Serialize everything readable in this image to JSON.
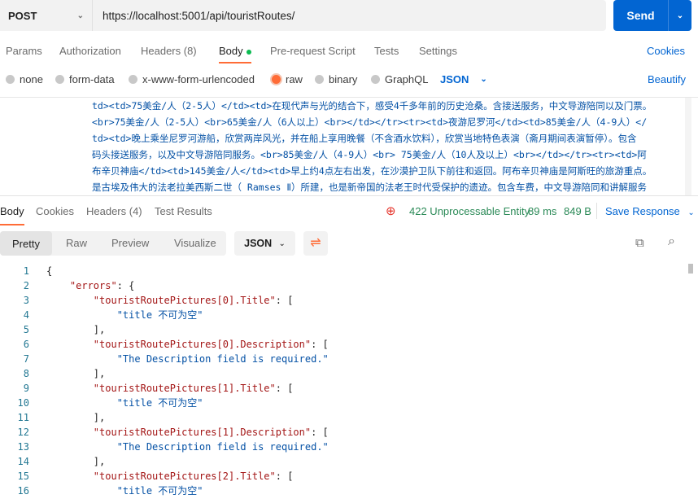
{
  "request": {
    "method": "POST",
    "url": "https://localhost:5001/api/touristRoutes/",
    "send_label": "Send"
  },
  "req_tabs": [
    "Params",
    "Authorization",
    "Headers (8)",
    "Body",
    "Pre-request Script",
    "Tests",
    "Settings"
  ],
  "cookies_label": "Cookies",
  "body_types": [
    "none",
    "form-data",
    "x-www-form-urlencoded",
    "raw",
    "binary",
    "GraphQL"
  ],
  "body_selected": "raw",
  "body_format": "JSON",
  "beautify_label": "Beautify",
  "body_lines": [
    "td><td>75美金/人（2-5人）</td><td>在现代声与光的结合下，感受4千多年前的历史沧桑。含接送服务，中文导游陪同以及门票。",
    "<br>75美金/人（2-5人）<br>65美金/人（6人以上）<br></td></tr><tr><td>夜游尼罗河</td><td>85美金/人（4-9人）</",
    "td><td>晚上乘坐尼罗河游船，欣赏两岸风光，并在船上享用晚餐（不含酒水饮料），欣赏当地特色表演（斋月期间表演暂停）。包含",
    "码头接送服务，以及中文导游陪同服务。<br>85美金/人（4-9人）<br> 75美金/人（10人及以上）<br></td></tr><tr><td>阿",
    "布辛贝神庙</td><td>145美金/人</td><td>早上约4点左右出发，在沙漠护卫队下前往和返回。阿布辛贝神庙是阿斯旺的旅游重点。",
    "是古埃及伟大的法老拉美西斯二世（ Ramses Ⅱ）所建，也是新帝国的法老王时代受保护的遗迹。包含车费，中文导游陪同和讲解服务"
  ],
  "resp_tabs": [
    "Body",
    "Cookies",
    "Headers (4)",
    "Test Results"
  ],
  "status": {
    "code_text": "422 Unprocessable Entity",
    "time": "89 ms",
    "size": "849 B",
    "save_label": "Save Response"
  },
  "view_modes": [
    "Pretty",
    "Raw",
    "Preview",
    "Visualize"
  ],
  "resp_format": "JSON",
  "code_lines": [
    {
      "n": "1",
      "parts": [
        [
          "p",
          "{"
        ]
      ]
    },
    {
      "n": "2",
      "parts": [
        [
          "k",
          "    \"errors\""
        ],
        [
          "p",
          ": {"
        ]
      ]
    },
    {
      "n": "3",
      "parts": [
        [
          "k",
          "        \"touristRoutePictures[0].Title\""
        ],
        [
          "p",
          ": ["
        ]
      ]
    },
    {
      "n": "4",
      "parts": [
        [
          "v",
          "            \"title 不可为空\""
        ]
      ]
    },
    {
      "n": "5",
      "parts": [
        [
          "p",
          "        ],"
        ]
      ]
    },
    {
      "n": "6",
      "parts": [
        [
          "k",
          "        \"touristRoutePictures[0].Description\""
        ],
        [
          "p",
          ": ["
        ]
      ]
    },
    {
      "n": "7",
      "parts": [
        [
          "v",
          "            \"The Description field is required.\""
        ]
      ]
    },
    {
      "n": "8",
      "parts": [
        [
          "p",
          "        ],"
        ]
      ]
    },
    {
      "n": "9",
      "parts": [
        [
          "k",
          "        \"touristRoutePictures[1].Title\""
        ],
        [
          "p",
          ": ["
        ]
      ]
    },
    {
      "n": "10",
      "parts": [
        [
          "v",
          "            \"title 不可为空\""
        ]
      ]
    },
    {
      "n": "11",
      "parts": [
        [
          "p",
          "        ],"
        ]
      ]
    },
    {
      "n": "12",
      "parts": [
        [
          "k",
          "        \"touristRoutePictures[1].Description\""
        ],
        [
          "p",
          ": ["
        ]
      ]
    },
    {
      "n": "13",
      "parts": [
        [
          "v",
          "            \"The Description field is required.\""
        ]
      ]
    },
    {
      "n": "14",
      "parts": [
        [
          "p",
          "        ],"
        ]
      ]
    },
    {
      "n": "15",
      "parts": [
        [
          "k",
          "        \"touristRoutePictures[2].Title\""
        ],
        [
          "p",
          ": ["
        ]
      ]
    },
    {
      "n": "16",
      "parts": [
        [
          "v",
          "            \"title 不可为空\""
        ]
      ]
    }
  ],
  "colors": {
    "accent": "#ff6c37",
    "send": "#0265d2",
    "status": "#2b8a57",
    "error_icon": "#e5332a"
  }
}
